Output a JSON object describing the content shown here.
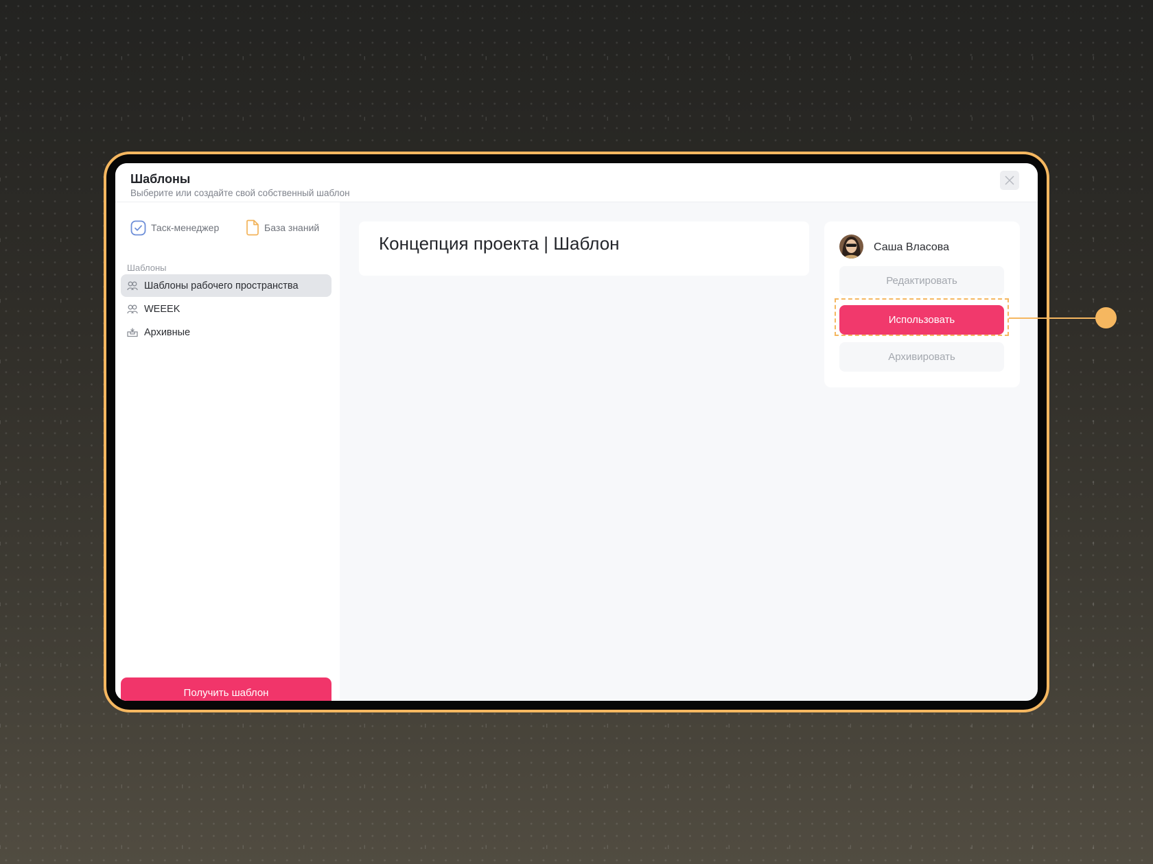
{
  "header": {
    "title": "Шаблоны",
    "subtitle": "Выберите или создайте свой собственный шаблон"
  },
  "sidebar": {
    "tabs": [
      {
        "label": "Таск-менеджер",
        "icon": "check-square-icon"
      },
      {
        "label": "База знаний",
        "icon": "document-icon"
      }
    ],
    "section_label": "Шаблоны",
    "items": [
      {
        "label": "Шаблоны рабочего пространства",
        "icon": "users-icon",
        "active": true
      },
      {
        "label": "WEEEK",
        "icon": "users-icon",
        "active": false
      },
      {
        "label": "Архивные",
        "icon": "archive-icon",
        "active": false
      }
    ],
    "get_template_button": "Получить шаблон"
  },
  "document": {
    "title": "Концепция проекта | Шаблон"
  },
  "author_panel": {
    "user_name": "Саша Власова",
    "edit_button": "Редактировать",
    "use_button": "Использовать",
    "archive_button": "Архивировать"
  },
  "colors": {
    "accent": "#f1396c",
    "frame": "#f5b760",
    "check_icon": "#6e8fd8",
    "doc_icon": "#f2b35a"
  }
}
